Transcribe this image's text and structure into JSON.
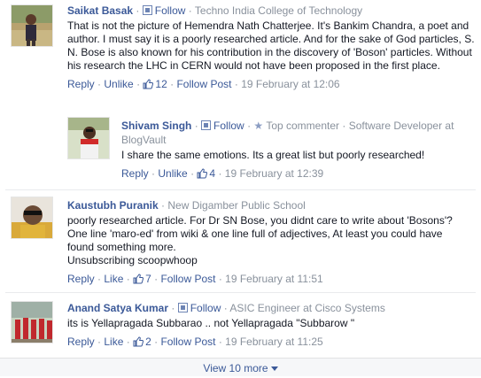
{
  "comments": [
    {
      "name": "Saikat Basak",
      "follow": "Follow",
      "meta": "Techno India College of Technology",
      "text": "That is not the picture of Hemendra Nath Chatterjee. It's Bankim Chandra, a poet and author. I must say it is a poorly researched article. And for the sake of God particles, S. N. Bose is also known for his contribution in the discovery of 'Boson' particles. Without his research the LHC in CERN would not have been proposed in the first place.",
      "reply": "Reply",
      "like": "Unlike",
      "likes": "12",
      "follow_post": "Follow Post",
      "time": "19 February at 12:06"
    },
    {
      "name": "Shivam Singh",
      "follow": "Follow",
      "badge": "Top commenter",
      "meta_line1": "Software Developer at",
      "meta_line2": "BlogVault",
      "text": "I share the same emotions. Its a great list but poorly researched!",
      "reply": "Reply",
      "like": "Unlike",
      "likes": "4",
      "time": "19 February at 12:39"
    },
    {
      "name": "Kaustubh Puranik",
      "meta": "New Digamber Public School",
      "text_lines": [
        "poorly researched article. For Dr SN Bose, you didnt care to write about 'Bosons'?",
        "One line 'maro-ed' from wiki & one line full of adjectives, At least you could have",
        "found something more.",
        "Unsubscribing scoopwhoop"
      ],
      "reply": "Reply",
      "like": "Like",
      "likes": "7",
      "follow_post": "Follow Post",
      "time": "19 February at 11:51"
    },
    {
      "name": "Anand Satya Kumar",
      "follow": "Follow",
      "meta": "ASIC Engineer at Cisco Systems",
      "text": "its is Yellapragada Subbarao .. not Yellapragada \"Subbarow \"",
      "reply": "Reply",
      "like": "Like",
      "likes": "2",
      "follow_post": "Follow Post",
      "time": "19 February at 11:25"
    }
  ],
  "view_more": "View 10 more",
  "colors": {
    "link": "#3b5998",
    "meta": "#89919c",
    "text": "#141823"
  },
  "icons": {
    "follow": "follow-feed-icon",
    "like": "thumbs-up-icon",
    "badge": "star-icon",
    "more": "caret-down-icon"
  }
}
